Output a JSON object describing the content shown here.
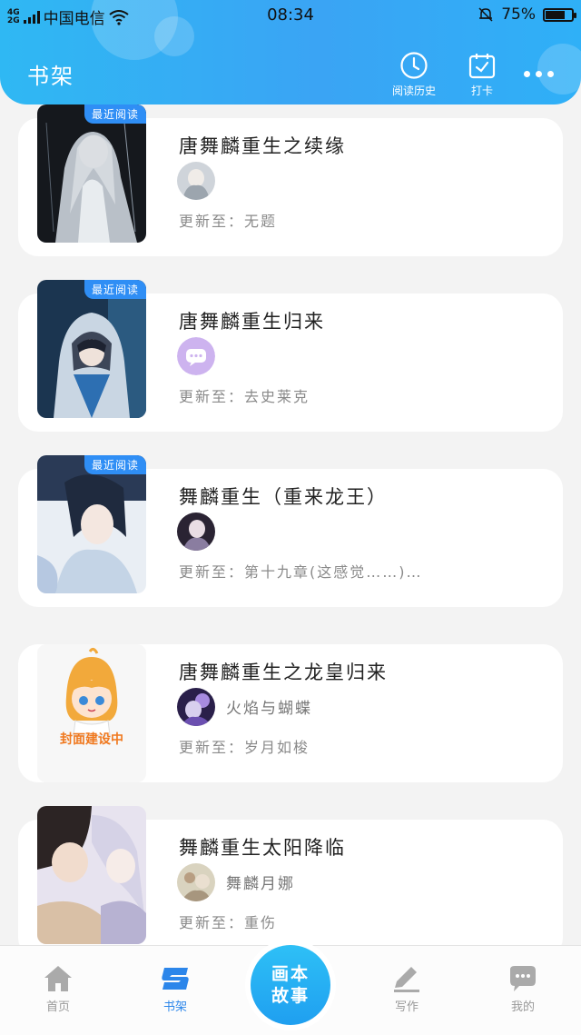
{
  "status_bar": {
    "network_top": "4G",
    "network_bottom": "2G",
    "carrier": "中国电信",
    "time": "08:34",
    "battery_percent": "75%",
    "battery_level": 0.75
  },
  "header": {
    "title": "书架",
    "history_label": "阅读历史",
    "checkin_label": "打卡",
    "more_icon": "more-dots-icon",
    "gradient": [
      "#2fb8f3",
      "#3aa4f4"
    ]
  },
  "badge": "最近阅读",
  "books": [
    {
      "title": "唐舞麟重生之续缘",
      "author": "",
      "update_prefix": "更新至：",
      "update": "无题",
      "recent": true,
      "cover_colors": [
        "#1a1d22",
        "#9aa3ad"
      ]
    },
    {
      "title": "唐舞麟重生归来",
      "author": "",
      "update_prefix": "更新至：",
      "update": "去史莱克",
      "recent": true,
      "cover_colors": [
        "#1e3f5e",
        "#b7cbe0"
      ]
    },
    {
      "title": "舞麟重生（重来龙王）",
      "author": "",
      "update_prefix": "更新至：",
      "update": "第十九章(这感觉……)…",
      "recent": true,
      "cover_colors": [
        "#2b3a55",
        "#dfe7f0"
      ]
    },
    {
      "title": "唐舞麟重生之龙皇归来",
      "author": "火焰与蝴蝶",
      "update_prefix": "更新至：",
      "update": "岁月如梭",
      "recent": false,
      "cover_placeholder": "封面建设中",
      "cover_colors": [
        "#f7f7f7",
        "#f0791f"
      ]
    },
    {
      "title": "舞麟重生太阳降临",
      "author": "舞麟月娜",
      "update_prefix": "更新至：",
      "update": "重伤",
      "recent": false,
      "cover_colors": [
        "#3a3030",
        "#d9d6e6"
      ]
    }
  ],
  "bottom_nav": {
    "home": "首页",
    "shelf": "书架",
    "center_line1": "画本",
    "center_line2": "故事",
    "write": "写作",
    "mine": "我的",
    "active": "shelf"
  },
  "colors": {
    "accent": "#2c86ea",
    "badge": "#2f8ef5",
    "placeholder_orange": "#f0791f"
  }
}
